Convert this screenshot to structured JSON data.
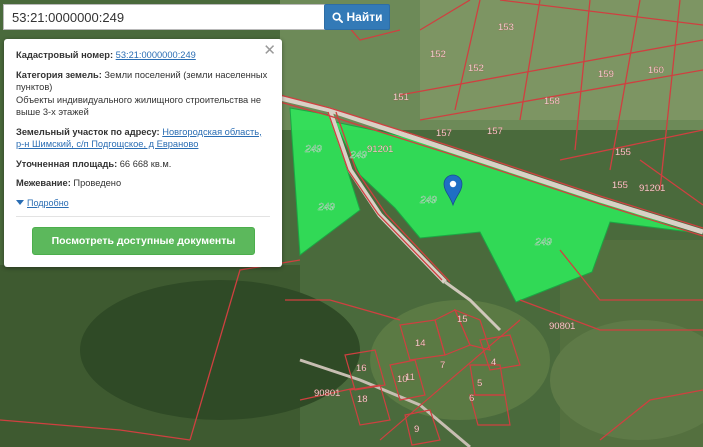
{
  "search": {
    "value": "53:21:0000000:249",
    "button_label": "Найти"
  },
  "info": {
    "cadastral_label": "Кадастровый номер:",
    "cadastral_value": "53:21:0000000:249",
    "category_label": "Категория земель:",
    "category_value": "Земли поселений (земли населенных пунктов)",
    "use_value": "Объекты индивидуального жилищного строительства не выше 3-х этажей",
    "address_label": "Земельный участок по адресу:",
    "address_value": "Новгородская область, р-н Шимский, с/п Подгощское, д Евраново",
    "area_label": "Уточненная площадь:",
    "area_value": "66 668 кв.м.",
    "survey_label": "Межевание:",
    "survey_value": "Проведено",
    "more_label": "Подробно",
    "docs_button": "Посмотреть доступные документы"
  },
  "map": {
    "parcel_labels": [
      "249",
      "249",
      "249",
      "249",
      "249"
    ],
    "number_labels": [
      "153",
      "152",
      "152",
      "151",
      "159",
      "160",
      "158",
      "157",
      "157",
      "155",
      "155",
      "91201",
      "91201",
      "90801",
      "90801",
      "14",
      "15",
      "4",
      "5",
      "6",
      "7",
      "9",
      "10",
      "11",
      "16",
      "18"
    ],
    "colors": {
      "parcel_fill": "#2ee85a",
      "boundary": "#cf4040",
      "road": "#d9d1c6",
      "marker": "#1f6fc4"
    }
  }
}
